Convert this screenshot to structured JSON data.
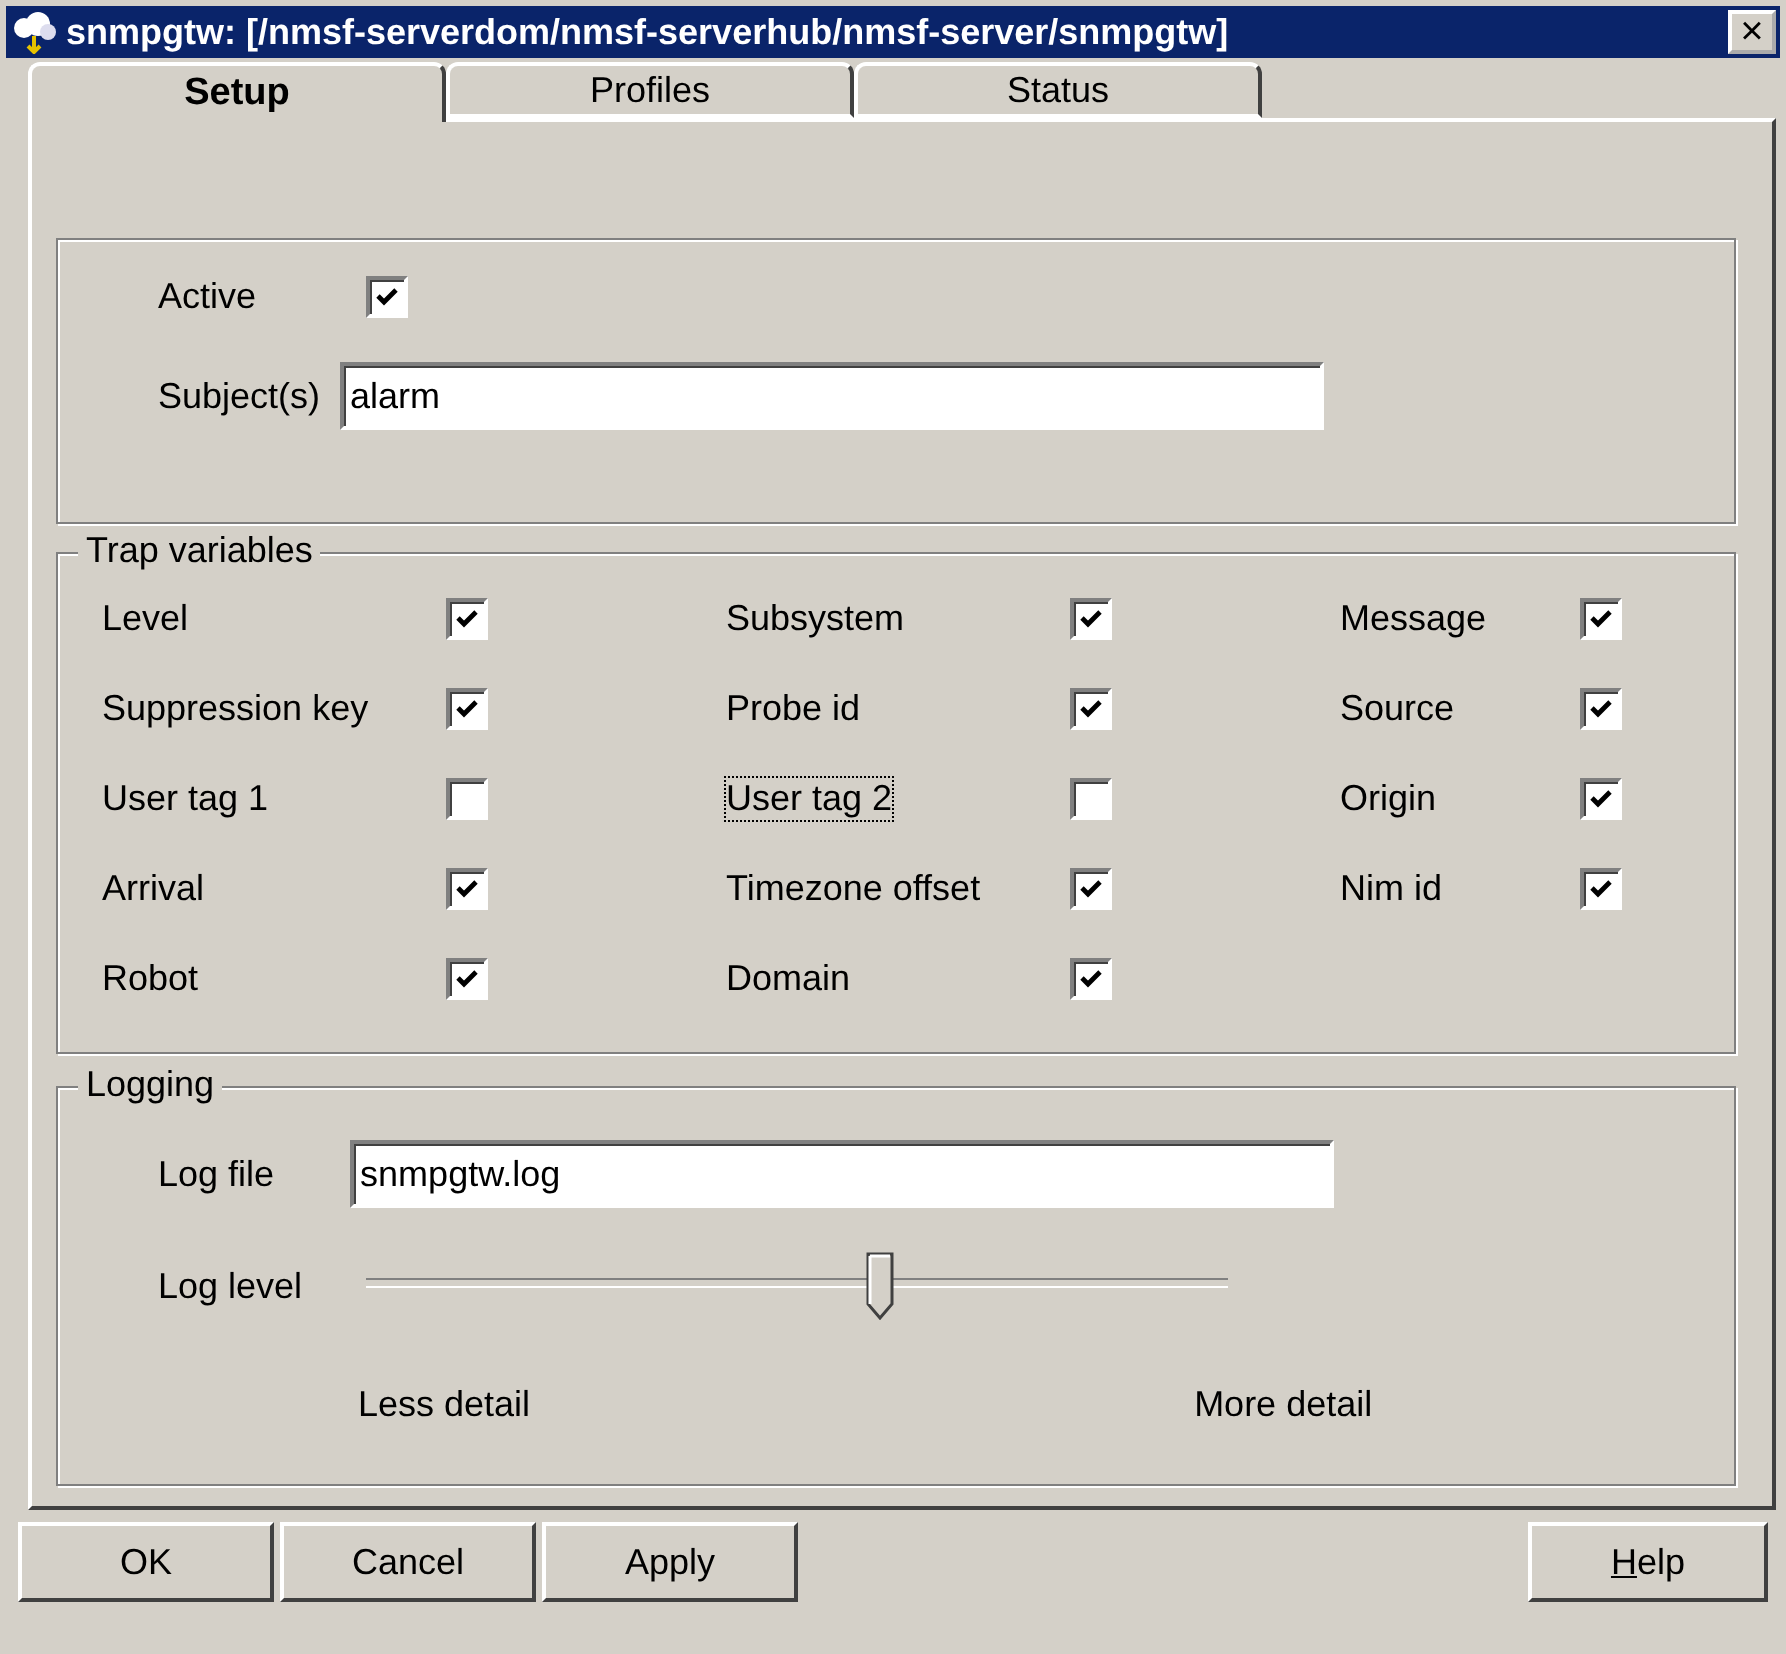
{
  "window": {
    "title": "snmpgtw: [/nmsf-serverdom/nmsf-serverhub/nmsf-server/snmpgtw]",
    "close": "×"
  },
  "tabs": [
    {
      "label": "Setup",
      "selected": true
    },
    {
      "label": "Profiles",
      "selected": false
    },
    {
      "label": "Status",
      "selected": false
    }
  ],
  "general": {
    "active": {
      "label": "Active",
      "checked": true
    },
    "subjects": {
      "label": "Subject(s)",
      "value": "alarm"
    }
  },
  "trap_variables": {
    "title": "Trap variables",
    "items": [
      {
        "label": "Level",
        "checked": true,
        "focused": false
      },
      {
        "label": "Subsystem",
        "checked": true,
        "focused": false
      },
      {
        "label": "Message",
        "checked": true,
        "focused": false
      },
      {
        "label": "Suppression key",
        "checked": true,
        "focused": false
      },
      {
        "label": "Probe id",
        "checked": true,
        "focused": false
      },
      {
        "label": "Source",
        "checked": true,
        "focused": false
      },
      {
        "label": "User tag 1",
        "checked": false,
        "focused": false
      },
      {
        "label": "User tag 2",
        "checked": false,
        "focused": true
      },
      {
        "label": "Origin",
        "checked": true,
        "focused": false
      },
      {
        "label": "Arrival",
        "checked": true,
        "focused": false
      },
      {
        "label": "Timezone offset",
        "checked": true,
        "focused": false
      },
      {
        "label": "Nim id",
        "checked": true,
        "focused": false
      },
      {
        "label": "Robot",
        "checked": true,
        "focused": false
      },
      {
        "label": "Domain",
        "checked": true,
        "focused": false
      }
    ]
  },
  "logging": {
    "title": "Logging",
    "log_file": {
      "label": "Log file",
      "value": "snmpgtw.log"
    },
    "log_level": {
      "label": "Log level",
      "level": 0.6,
      "min_label": "Less detail",
      "max_label": "More detail"
    }
  },
  "buttons": [
    {
      "label": "OK",
      "underline_first": false
    },
    {
      "label": "Cancel",
      "underline_first": false
    },
    {
      "label": "Apply",
      "underline_first": false
    },
    {
      "label": "Help",
      "underline_first": true
    }
  ]
}
